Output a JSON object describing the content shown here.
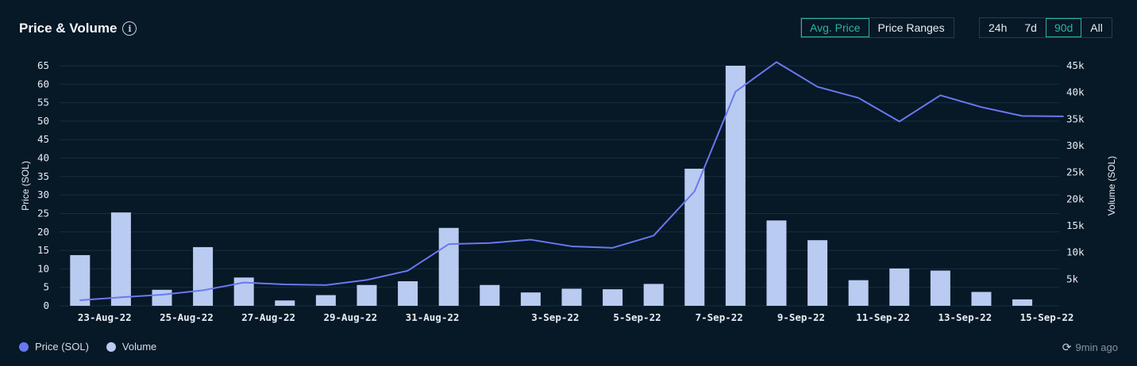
{
  "header": {
    "title": "Price & Volume",
    "info_icon": "info-icon"
  },
  "toggles": {
    "metric": [
      {
        "label": "Avg. Price",
        "active": true
      },
      {
        "label": "Price Ranges",
        "active": false
      }
    ],
    "range": [
      {
        "label": "24h",
        "active": false
      },
      {
        "label": "7d",
        "active": false
      },
      {
        "label": "90d",
        "active": true
      },
      {
        "label": "All",
        "active": false
      }
    ]
  },
  "legend": {
    "price": "Price (SOL)",
    "volume": "Volume"
  },
  "footer": {
    "updated": "9min ago",
    "refresh_icon": "refresh-clock-icon"
  },
  "colors": {
    "background": "#071827",
    "price_line": "#6a78f0",
    "volume_bar": "#b9cbf0",
    "accent": "#2bb3a3",
    "grid": "#15303f"
  },
  "chart_data": {
    "type": "bar",
    "ylabel": "Price (SOL)",
    "y2label": "Volume (SOL)",
    "ylim": [
      0,
      65
    ],
    "y2lim": [
      0,
      45000
    ],
    "yticks": [
      0,
      5,
      10,
      15,
      20,
      25,
      30,
      35,
      40,
      45,
      50,
      55,
      60,
      65
    ],
    "y2ticks": [
      "5k",
      "10k",
      "15k",
      "20k",
      "25k",
      "30k",
      "35k",
      "40k",
      "45k"
    ],
    "y2tick_values": [
      5000,
      10000,
      15000,
      20000,
      25000,
      30000,
      35000,
      40000,
      45000
    ],
    "x_labels": [
      "23-Aug-22",
      "25-Aug-22",
      "27-Aug-22",
      "29-Aug-22",
      "31-Aug-22",
      "3-Sep-22",
      "5-Sep-22",
      "7-Sep-22",
      "9-Sep-22",
      "11-Sep-22",
      "13-Sep-22",
      "15-Sep-22"
    ],
    "x_label_slots": [
      1,
      3,
      5,
      7,
      9,
      12,
      14,
      16,
      18,
      20,
      22,
      24
    ],
    "grid": true,
    "legend_position": "bottom-left",
    "series": [
      {
        "name": "Volume",
        "axis": "right",
        "kind": "bar",
        "values": [
          9500,
          17500,
          3000,
          11000,
          5300,
          1000,
          2000,
          3900,
          4600,
          14600,
          3900,
          2500,
          3200,
          3100,
          4100,
          25700,
          45000,
          16000,
          12300,
          4800,
          7000,
          6600,
          2600,
          1200
        ]
      },
      {
        "name": "Price (SOL)",
        "axis": "left",
        "kind": "line",
        "values": [
          1.5,
          2.3,
          3.0,
          4.2,
          6.3,
          5.8,
          5.6,
          7.0,
          9.5,
          16.7,
          17.0,
          17.9,
          16.1,
          15.7,
          19.0,
          31.0,
          58.0,
          66.0,
          59.3,
          56.3,
          49.9,
          57.0,
          53.8,
          51.4,
          51.3
        ]
      }
    ]
  }
}
